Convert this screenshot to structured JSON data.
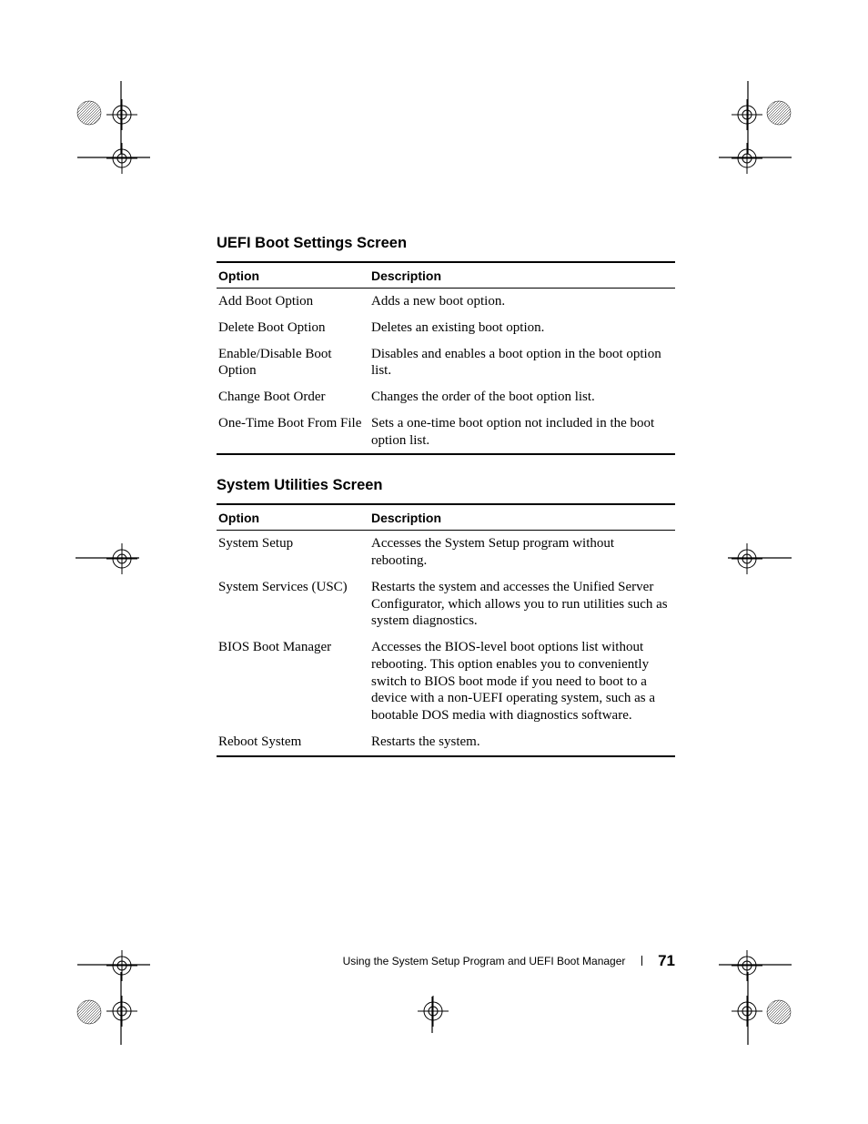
{
  "sections": [
    {
      "heading": "UEFI Boot Settings Screen",
      "columns": {
        "option": "Option",
        "description": "Description"
      },
      "rows": [
        {
          "option": "Add Boot Option",
          "description": "Adds a new boot option."
        },
        {
          "option": "Delete Boot Option",
          "description": "Deletes an existing boot option."
        },
        {
          "option": "Enable/Disable Boot Option",
          "description": "Disables and enables a boot option in the boot option list."
        },
        {
          "option": "Change Boot Order",
          "description": "Changes the order of the boot option list."
        },
        {
          "option": "One-Time Boot From File",
          "description": "Sets a one-time boot option not included in the boot option list."
        }
      ]
    },
    {
      "heading": "System Utilities Screen",
      "columns": {
        "option": "Option",
        "description": "Description"
      },
      "rows": [
        {
          "option": "System Setup",
          "description": "Accesses the System Setup program without rebooting."
        },
        {
          "option": "System Services (USC)",
          "description": "Restarts the system and accesses the Unified Server Configurator, which allows you to run utilities such as system diagnostics."
        },
        {
          "option": "BIOS Boot Manager",
          "description": "Accesses the BIOS-level boot options list without rebooting. This option enables you to conveniently switch to BIOS boot mode if you need to boot to a device with a non-UEFI operating system, such as a bootable DOS media with diagnostics software."
        },
        {
          "option": "Reboot System",
          "description": "Restarts the system."
        }
      ]
    }
  ],
  "footer": {
    "chapter": "Using the System Setup Program and UEFI Boot Manager",
    "page": "71"
  }
}
